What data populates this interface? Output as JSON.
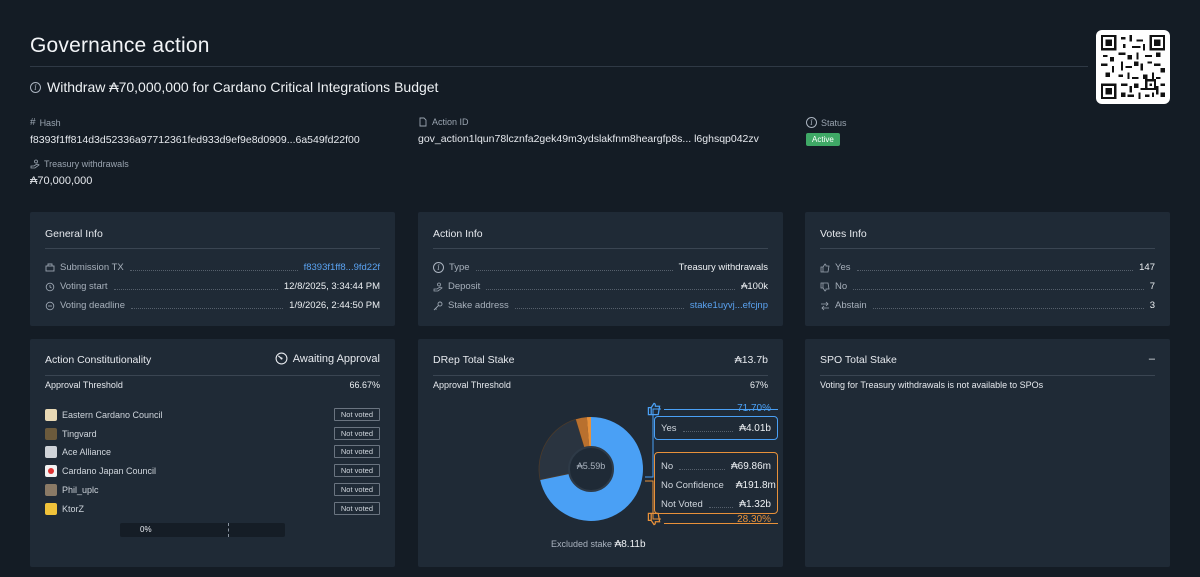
{
  "header": {
    "title": "Governance action",
    "subtitle": "Withdraw ₳70,000,000 for Cardano Critical Integrations Budget"
  },
  "meta": {
    "hash_label": "Hash",
    "hash_value": "f8393f1ff814d3d52336a97712361fed933d9ef9e8d0909...6a549fd22f00",
    "action_id_label": "Action ID",
    "action_id_value": "gov_action1lqun78lcznfa2gek49m3ydslakfnm8heargfp8s... l6ghsqp042zv",
    "status_label": "Status",
    "status_value": "Active",
    "treasury_label": "Treasury withdrawals",
    "treasury_value": "₳70,000,000"
  },
  "general_info": {
    "title": "General Info",
    "rows": [
      {
        "label": "Submission TX",
        "value": "f8393f1ff8...9fd22f"
      },
      {
        "label": "Voting start",
        "value": "12/8/2025, 3:34:44 PM"
      },
      {
        "label": "Voting deadline",
        "value": "1/9/2026, 2:44:50 PM"
      }
    ]
  },
  "action_info": {
    "title": "Action Info",
    "rows": [
      {
        "label": "Type",
        "value": "Treasury withdrawals"
      },
      {
        "label": "Deposit",
        "value": "₳100k"
      },
      {
        "label": "Stake address",
        "value": "stake1uyvj...efcjnp"
      }
    ]
  },
  "votes_info": {
    "title": "Votes Info",
    "rows": [
      {
        "label": "Yes",
        "value": "147"
      },
      {
        "label": "No",
        "value": "7"
      },
      {
        "label": "Abstain",
        "value": "3"
      }
    ]
  },
  "constitutionality": {
    "title": "Action Constitutionality",
    "status": "Awaiting Approval",
    "threshold_label": "Approval Threshold",
    "threshold_value": "66.67%",
    "members": [
      {
        "name": "Eastern Cardano Council",
        "vote": "Not voted"
      },
      {
        "name": "Tingvard",
        "vote": "Not voted"
      },
      {
        "name": "Ace Alliance",
        "vote": "Not voted"
      },
      {
        "name": "Cardano Japan Council",
        "vote": "Not voted"
      },
      {
        "name": "Phil_uplc",
        "vote": "Not voted"
      },
      {
        "name": "KtorZ",
        "vote": "Not voted"
      }
    ],
    "progress_label": "0%",
    "progress_fraction": 0
  },
  "drep": {
    "title": "DRep Total Stake",
    "total": "₳13.7b",
    "threshold_label": "Approval Threshold",
    "threshold_value": "67%",
    "center_label": "₳5.59b",
    "yes_pct": "71.70%",
    "yes_label": "Yes",
    "yes_value": "₳4.01b",
    "no_label": "No",
    "no_value": "₳69.86m",
    "noconf_label": "No Confidence",
    "noconf_value": "₳191.8m",
    "notvoted_label": "Not Voted",
    "notvoted_value": "₳1.32b",
    "no_pct": "28.30%",
    "excluded_label": "Excluded stake",
    "excluded_value": "₳8.11b",
    "donut": {
      "segments": [
        {
          "value": 71.7,
          "color": "#4aa0f5"
        },
        {
          "value": 23.6,
          "color": "#2a3440"
        },
        {
          "value": 3.43,
          "color": "#b9702e"
        },
        {
          "value": 1.27,
          "color": "#e8913a"
        }
      ]
    }
  },
  "spo": {
    "title": "SPO Total Stake",
    "total": "–",
    "note": "Voting for Treasury withdrawals is not available to SPOs"
  }
}
